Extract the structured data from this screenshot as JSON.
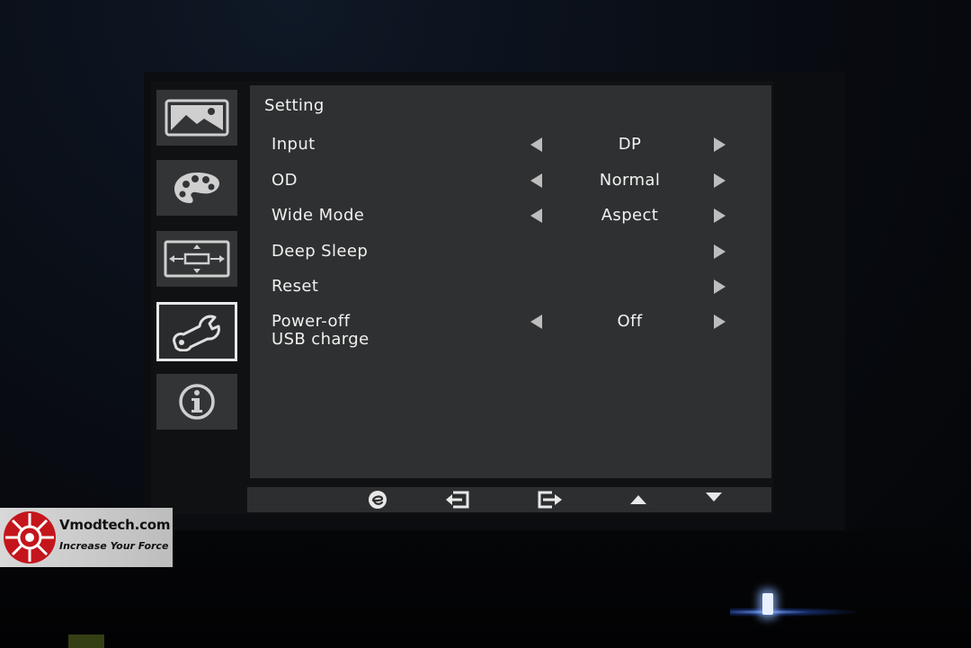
{
  "osd": {
    "title": "Setting",
    "sidebar": [
      {
        "icon": "picture-icon",
        "active": false
      },
      {
        "icon": "color-palette-icon",
        "active": false
      },
      {
        "icon": "display-position-icon",
        "active": false
      },
      {
        "icon": "wrench-setting-icon",
        "active": true
      },
      {
        "icon": "info-icon",
        "active": false
      }
    ],
    "rows": [
      {
        "label": "Input",
        "value": "DP",
        "has_left": true,
        "has_right": true
      },
      {
        "label": "OD",
        "value": "Normal",
        "has_left": true,
        "has_right": true
      },
      {
        "label": "Wide Mode",
        "value": "Aspect",
        "has_left": true,
        "has_right": true
      },
      {
        "label": "Deep Sleep",
        "value": "",
        "has_left": false,
        "has_right": true
      },
      {
        "label": "Reset",
        "value": "",
        "has_left": false,
        "has_right": true
      },
      {
        "label": "Power-off\nUSB charge",
        "value": "Off",
        "has_left": true,
        "has_right": true
      }
    ],
    "buttons": [
      {
        "icon": "e-key-icon"
      },
      {
        "icon": "exit-icon"
      },
      {
        "icon": "enter-icon"
      },
      {
        "icon": "up-arrow-icon"
      },
      {
        "icon": "down-arrow-icon"
      }
    ]
  },
  "watermark": {
    "name": "Vmodtech.com",
    "tagline": "Increase Your Force"
  },
  "colors": {
    "panel": "#2f3031",
    "tile": "#333436",
    "text": "#f0f0f0",
    "arrow": "#bdbdbd"
  }
}
